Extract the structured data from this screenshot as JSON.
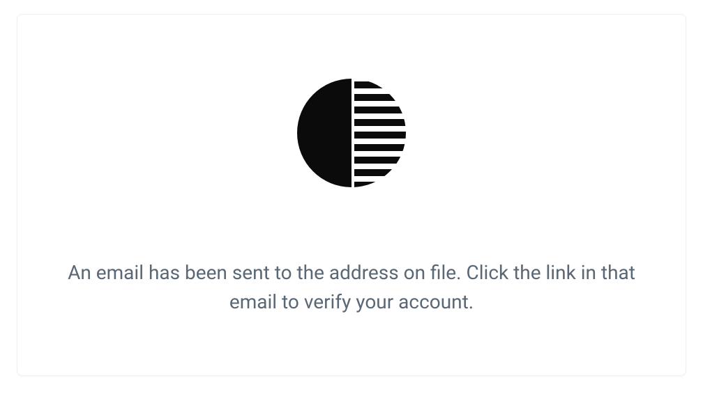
{
  "verification": {
    "message": "An email has been sent to the address on file. Click the link in that email to verify your account.",
    "icon": "half-striped-circle-logo"
  }
}
